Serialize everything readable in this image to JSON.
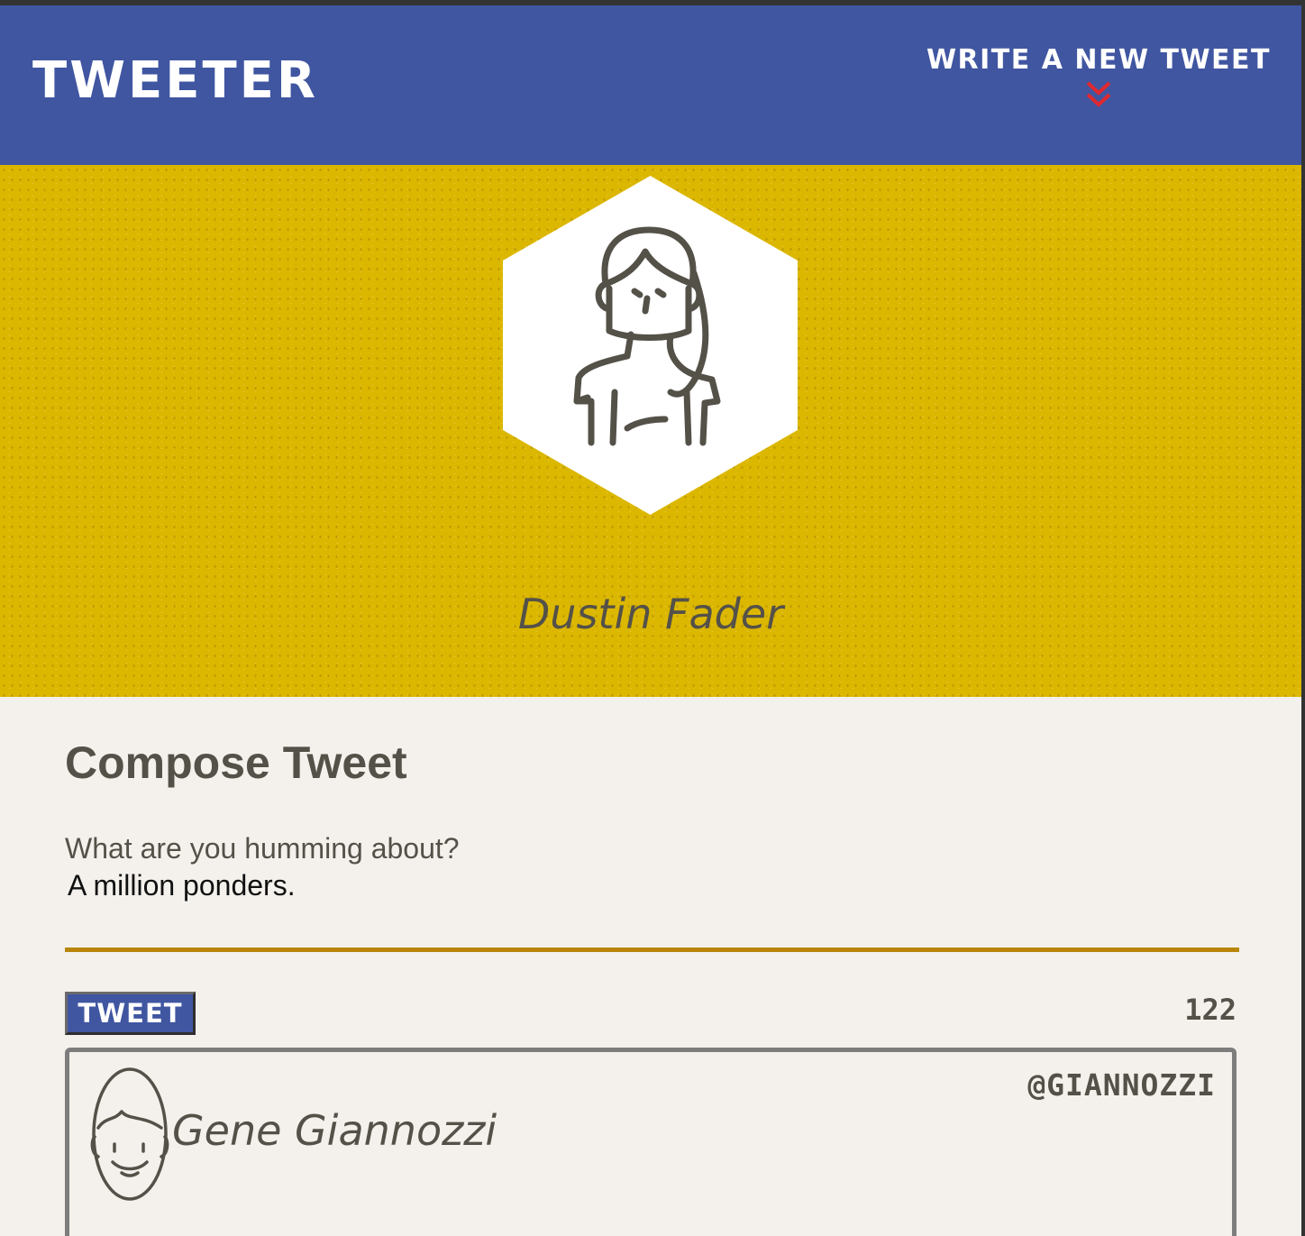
{
  "nav": {
    "brand": "TWEETER",
    "write_link_label": "WRITE A NEW TWEET",
    "write_link_icon": "double-chevron-down-icon",
    "arrow_color": "#e0282e"
  },
  "header": {
    "avatar_icon": "woman-avatar-icon",
    "user_name": "Dustin Fader"
  },
  "compose": {
    "title": "Compose Tweet",
    "prompt_label": "What are you humming about?",
    "text_value": "A million ponders.",
    "submit_label": "TWEET",
    "char_counter": "122"
  },
  "tweets": [
    {
      "avatar_icon": "man-avatar-icon",
      "name": "Gene Giannozzi",
      "handle": "@GIANNOZZI"
    }
  ],
  "colors": {
    "nav_bg": "#4056a1",
    "header_bg": "#dcb700",
    "page_bg": "#f4f1ec",
    "text": "#545149",
    "divider": "#b8860b"
  }
}
